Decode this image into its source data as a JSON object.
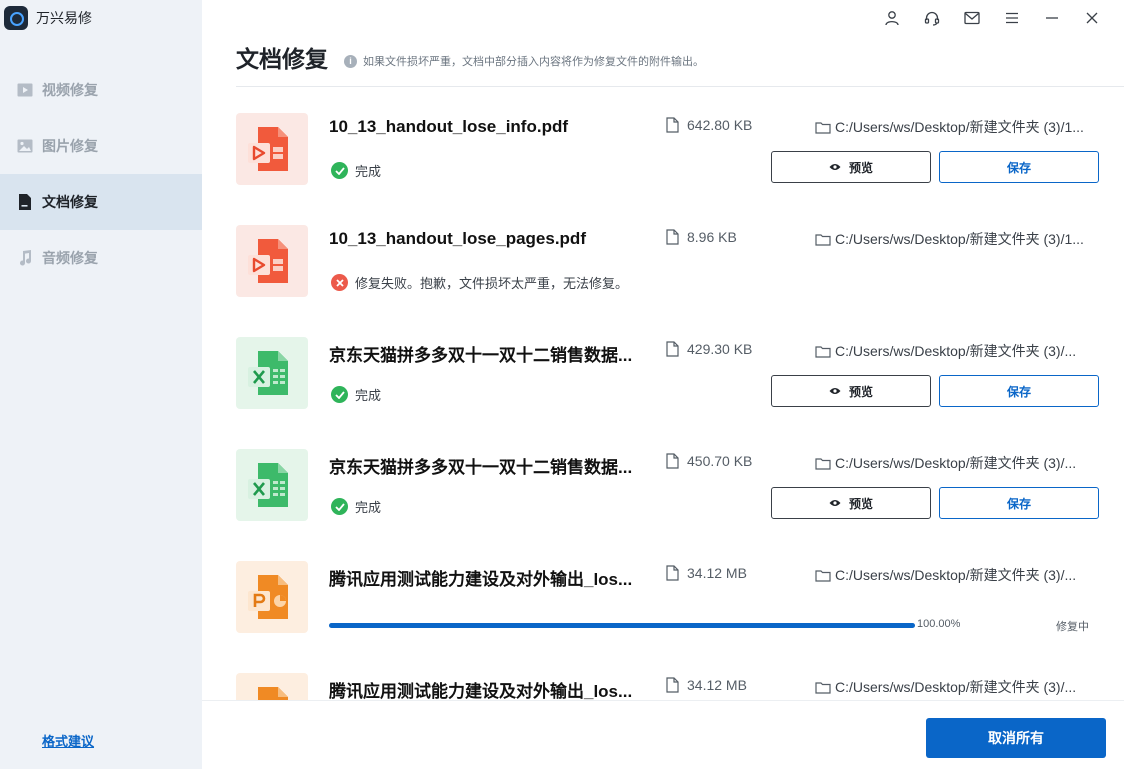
{
  "app": {
    "name": "万兴易修"
  },
  "sidebar": {
    "items": [
      {
        "label": "视频修复",
        "icon": "video-icon",
        "active": false
      },
      {
        "label": "图片修复",
        "icon": "image-icon",
        "active": false
      },
      {
        "label": "文档修复",
        "icon": "document-icon",
        "active": true
      },
      {
        "label": "音频修复",
        "icon": "music-icon",
        "active": false
      }
    ],
    "format_link": "格式建议"
  },
  "window_controls": [
    "user-icon",
    "headset-icon",
    "mail-icon",
    "menu-icon",
    "minimize-icon",
    "close-icon"
  ],
  "main": {
    "title": "文档修复",
    "hint": "如果文件损坏严重，文档中部分插入内容将作为修复文件的附件输出。",
    "preview_label": "预览",
    "save_label": "保存",
    "cancel_all_label": "取消所有"
  },
  "files": [
    {
      "name": "10_13_handout_lose_info.pdf",
      "type": "pdf",
      "size": "642.80  KB",
      "path": "C:/Users/ws/Desktop/新建文件夹 (3)/1...",
      "status": "ok",
      "status_text": "完成"
    },
    {
      "name": "10_13_handout_lose_pages.pdf",
      "type": "pdf",
      "size": "8.96  KB",
      "path": "C:/Users/ws/Desktop/新建文件夹 (3)/1...",
      "status": "error",
      "status_text": "修复失败。抱歉，文件损坏太严重，无法修复。"
    },
    {
      "name": "京东天猫拼多多双十一双十二销售数据...",
      "type": "xls",
      "size": "429.30  KB",
      "path": "C:/Users/ws/Desktop/新建文件夹 (3)/...",
      "status": "ok",
      "status_text": "完成"
    },
    {
      "name": "京东天猫拼多多双十一双十二销售数据...",
      "type": "xls",
      "size": "450.70  KB",
      "path": "C:/Users/ws/Desktop/新建文件夹 (3)/...",
      "status": "ok",
      "status_text": "完成"
    },
    {
      "name": "腾讯应用测试能力建设及对外输出_los...",
      "type": "ppt",
      "size": "34.12  MB",
      "path": "C:/Users/ws/Desktop/新建文件夹 (3)/...",
      "status": "progress",
      "progress": 1.0,
      "progress_text": "100.00%",
      "state_text": "修复中"
    },
    {
      "name": "腾讯应用测试能力建设及对外输出_los...",
      "type": "ppt",
      "size": "34.12  MB",
      "path": "C:/Users/ws/Desktop/新建文件夹 (3)/...",
      "status": "pending"
    }
  ],
  "colors": {
    "accent": "#0a66c8",
    "success": "#2fb45a",
    "error": "#ec5a4b",
    "sidebar_bg": "#eef2f7"
  }
}
